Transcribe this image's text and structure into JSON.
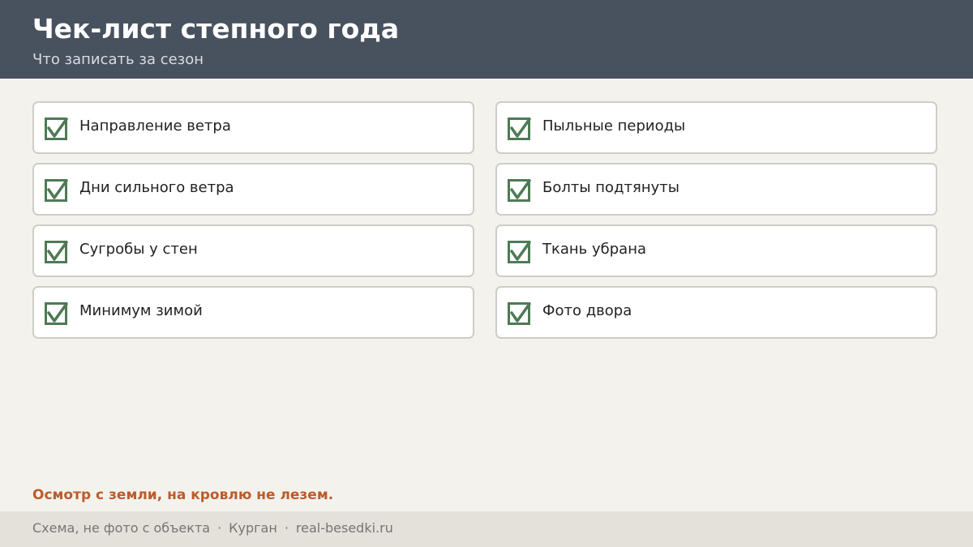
{
  "header": {
    "title": "Чек-лист степного года",
    "subtitle": "Что записать за сезон"
  },
  "checklist": {
    "left": [
      {
        "label": "Направление ветра",
        "checked": true
      },
      {
        "label": "Дни сильного ветра",
        "checked": true
      },
      {
        "label": "Сугробы у стен",
        "checked": true
      },
      {
        "label": "Минимум зимой",
        "checked": true
      }
    ],
    "right": [
      {
        "label": "Пыльные периоды",
        "checked": true
      },
      {
        "label": "Болты подтянуты",
        "checked": true
      },
      {
        "label": "Ткань убрана",
        "checked": true
      },
      {
        "label": "Фото двора",
        "checked": true
      }
    ]
  },
  "warning": "Осмотр с земли, на кровлю не лезем.",
  "footer": {
    "note": "Схема, не фото с объекта",
    "city": "Курган",
    "site": "real-besedki.ru",
    "separator": "·"
  },
  "colors": {
    "header_bg": "#48525f",
    "check_green": "#4e7a55",
    "warning_orange": "#bd5b2b"
  },
  "icons": {
    "checkbox": "checkmark-icon"
  }
}
